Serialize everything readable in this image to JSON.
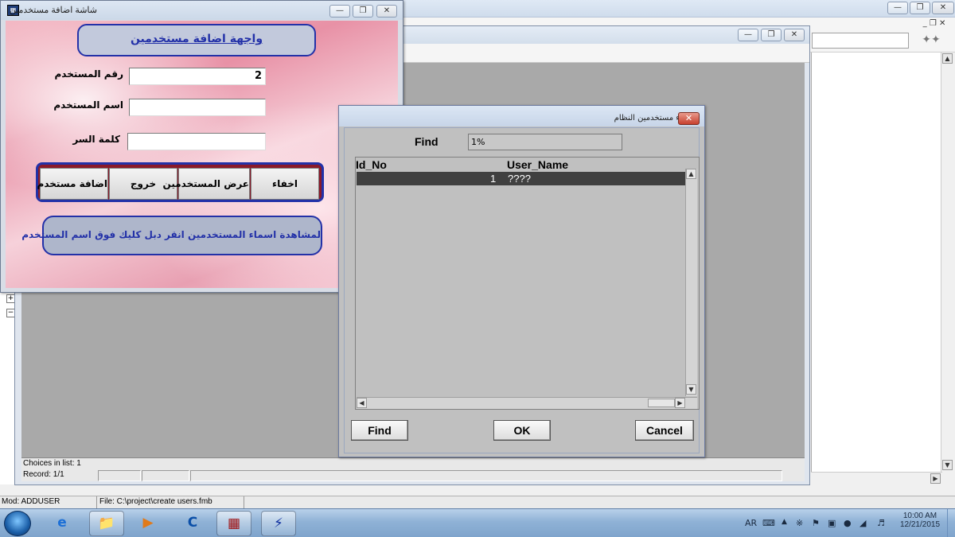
{
  "user_form": {
    "window_title": "شاشة اضافة مستخدمين",
    "heading": "واجهة اضافة مستخدمين",
    "user_number_label": "رقم المستخدم",
    "user_number_value": "2",
    "user_name_label": "اسم المستخدم",
    "user_name_value": "",
    "password_label": "كلمة السر",
    "password_value": "",
    "buttons": {
      "add_user": "اضافة مستخدم",
      "exit": "خروج",
      "show_users": "عرض المستخدمين",
      "hide": "اخفاء"
    },
    "hint": "لمشاهدة اسماء المستخدمين انقر دبل كليك فوق اسم المستخدم"
  },
  "lov_dialog": {
    "title": "اسماء مستخدمين النظام",
    "find_label": "Find",
    "find_value": "1%",
    "columns": [
      "Id_No",
      "User_Name"
    ],
    "rows": [
      {
        "id": "1",
        "name": "????"
      }
    ],
    "buttons": {
      "find": "Find",
      "ok": "OK",
      "cancel": "Cancel"
    }
  },
  "forms_window": {
    "status_line1": "Choices in list: 1",
    "status_line2": "Record: 1/1"
  },
  "app_status": {
    "module": "Mod: ADDUSER",
    "file": "File: C:\\project\\create users.fmb"
  },
  "taskbar": {
    "language": "AR",
    "time": "10:00 AM",
    "date": "12/21/2015"
  },
  "colors": {
    "form_border": "#2331a8",
    "hint_text": "#2331a8",
    "button_bar": "#8a1a2a",
    "selected_row": "#404040"
  },
  "icons": [
    "windows-start-icon",
    "ie-icon",
    "explorer-icon",
    "media-player-icon",
    "app-icon",
    "forms-icon",
    "forms-runtime-icon"
  ]
}
